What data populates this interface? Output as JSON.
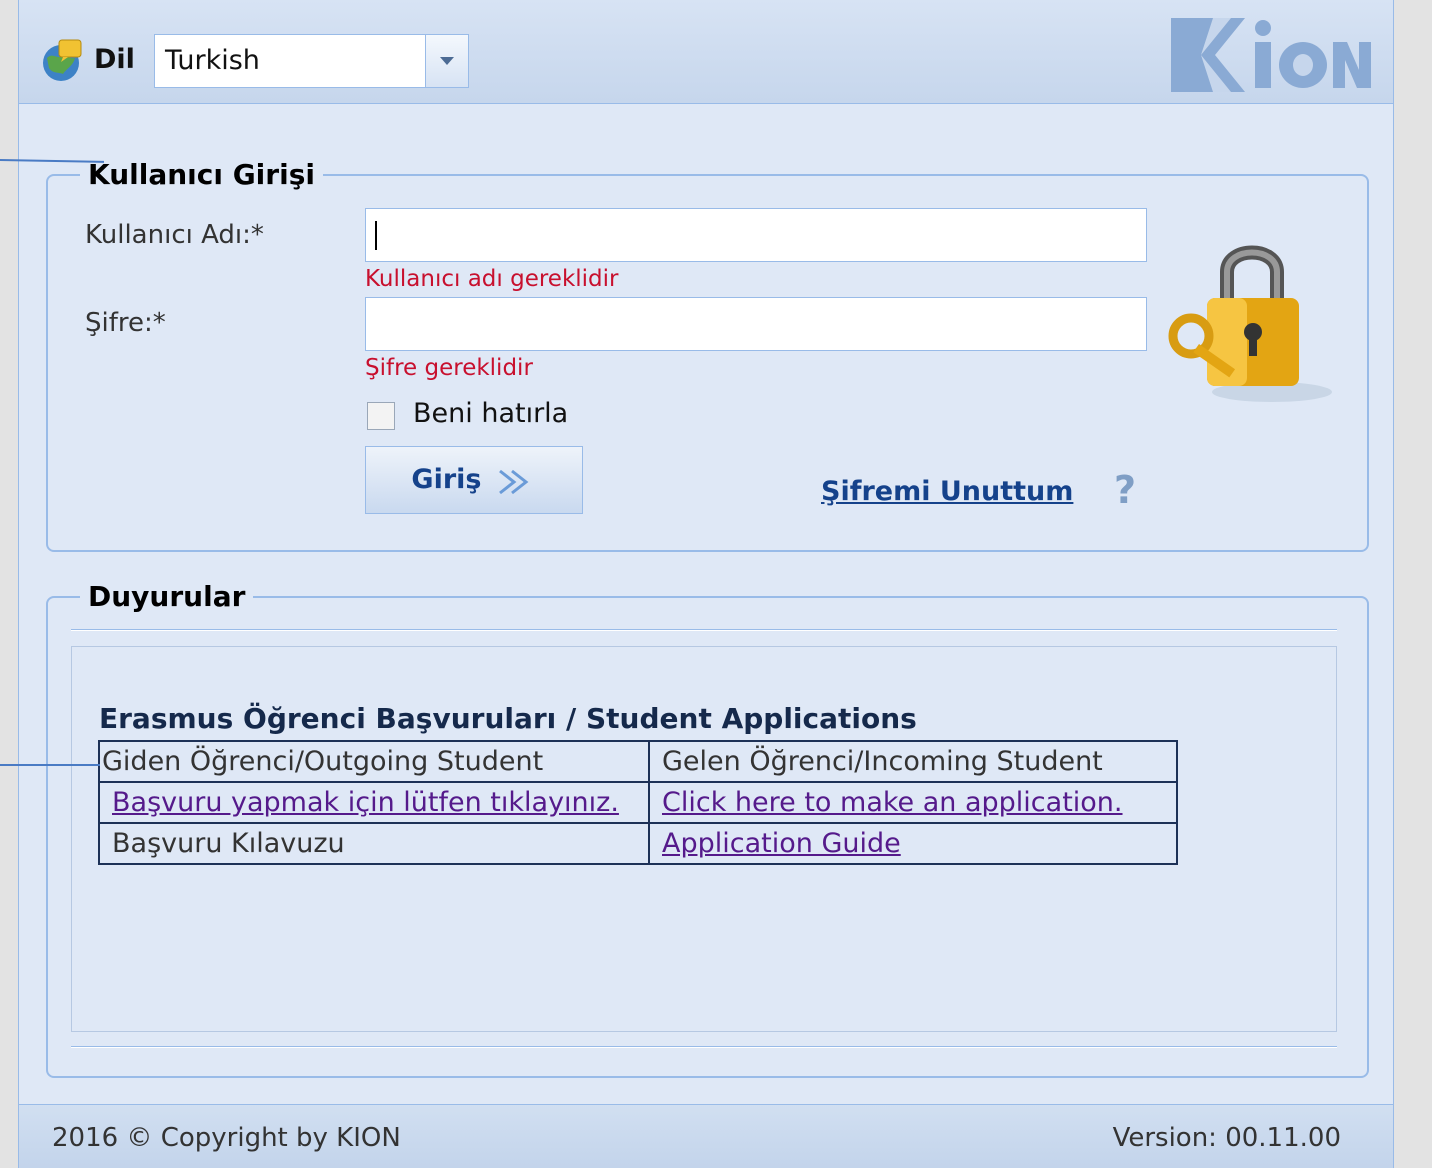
{
  "header": {
    "language_label": "Dil",
    "language_value": "Turkish",
    "logo_text": "KION"
  },
  "login": {
    "legend": "Kullanıcı Girişi",
    "username_label": "Kullanıcı Adı:*",
    "username_value": "",
    "username_error": "Kullanıcı adı gereklidir",
    "password_label": "Şifre:*",
    "password_value": "",
    "password_error": "Şifre gereklidir",
    "remember_label": "Beni hatırla",
    "remember_checked": false,
    "login_button": "Giriş",
    "forgot_link": "Şifremi Unuttum",
    "help_glyph": "?"
  },
  "announcements": {
    "legend": "Duyurular",
    "heading": "Erasmus Öğrenci Başvuruları / Student Applications",
    "table": {
      "headers": [
        "Giden Öğrenci/Outgoing Student",
        "Gelen Öğrenci/Incoming Student"
      ],
      "apply_links": [
        "Başvuru yapmak için lütfen tıklayınız.",
        "Click here to make an application."
      ],
      "guide_row": [
        "Başvuru Kılavuzu",
        "Application Guide"
      ]
    }
  },
  "footer": {
    "copyright": "2016 © Copyright by KION",
    "version": "Version: 00.11.00"
  },
  "colors": {
    "panel_bg": "#dfe8f6",
    "border": "#99bbe8",
    "error": "#c8102e",
    "link": "#551a8b",
    "accent": "#15428b"
  }
}
